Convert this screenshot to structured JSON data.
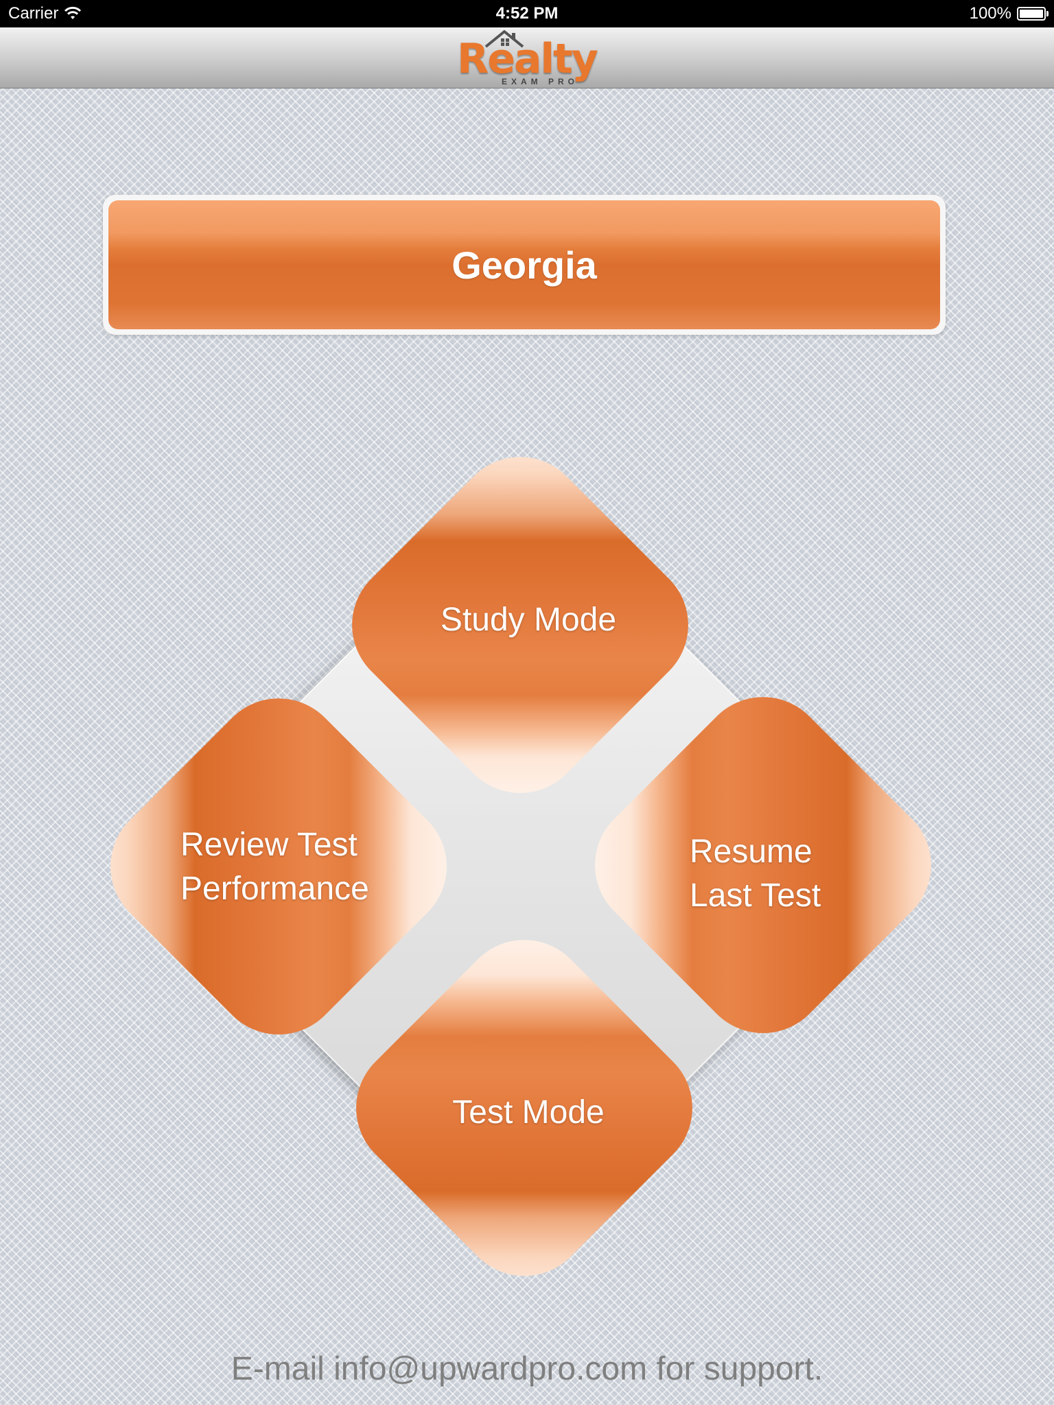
{
  "status_bar": {
    "carrier": "Carrier",
    "time": "4:52 PM",
    "battery": "100%"
  },
  "nav": {
    "logo_text": "Realty",
    "logo_subtext": "EXAM PRO"
  },
  "state": {
    "label": "Georgia"
  },
  "menu": {
    "study_mode": "Study Mode",
    "test_mode": "Test Mode",
    "review_line1": "Review Test",
    "review_line2": "Performance",
    "resume_line1": "Resume",
    "resume_line2": "Last Test"
  },
  "footer": {
    "support_text": "E-mail info@upwardpro.com for support."
  },
  "colors": {
    "accent_orange": "#e47d3c",
    "status_bar_bg": "#000000",
    "background": "#cdd2da"
  }
}
